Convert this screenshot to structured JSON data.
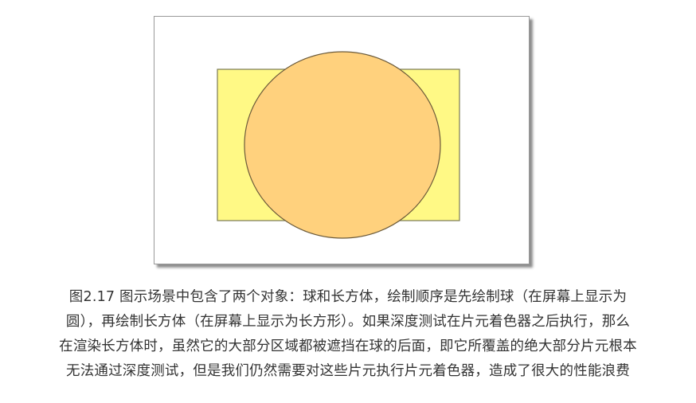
{
  "figure": {
    "colors": {
      "box_fill": "#fff985",
      "box_stroke": "#7a7a55",
      "sphere_fill": "#ffd17d",
      "sphere_stroke": "#6b5a3a"
    }
  },
  "caption": {
    "lines": [
      "图2.17 图示场景中包含了两个对象：球和长方体，绘制顺序是先绘制球（在屏幕上显示为",
      "圆），再绘制长方体（在屏幕上显示为长方形）。如果深度测试在片元着色器之后执行，那么",
      "在渲染长方体时，虽然它的大部分区域都被遮挡在球的后面，即它所覆盖的绝大部分片元根本",
      "无法通过深度测试，但是我们仍然需要对这些片元执行片元着色器，造成了很大的性能浪费"
    ]
  }
}
